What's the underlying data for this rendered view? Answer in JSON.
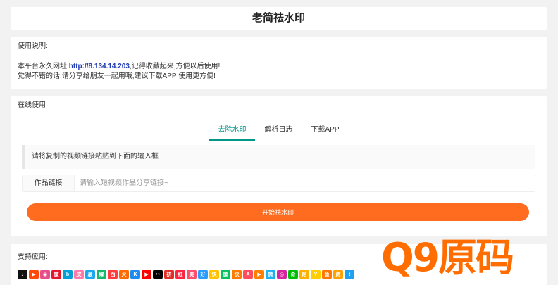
{
  "title": "老简祛水印",
  "info": {
    "header": "使用说明:",
    "line1_prefix": "本平台永久网址:",
    "url": "http://8.134.14.203",
    "line1_suffix": ",记得收藏起来,方便以后使用!",
    "line2": "觉得不错的话,请分享给朋友一起用哦,建议下载APP 使用更方便!"
  },
  "tool": {
    "header": "在线使用",
    "tabs": [
      {
        "label": "去除水印"
      },
      {
        "label": "解析日志"
      },
      {
        "label": "下载APP"
      }
    ],
    "notice": "请将复制的视频链接粘贴到下面的输入框",
    "input_label": "作品链接",
    "input_placeholder": "请输入短视频作品分享链接~",
    "input_value": "",
    "button_label": "开始祛水印"
  },
  "apps": {
    "header": "支持应用:",
    "icons": [
      {
        "name": "douyin-icon",
        "color": "#111111",
        "glyph": "♪"
      },
      {
        "name": "kuaishou-icon",
        "color": "#ff4906",
        "glyph": "▶"
      },
      {
        "name": "weishi-icon",
        "color": "#e64d8a",
        "glyph": "◉"
      },
      {
        "name": "weibo-icon",
        "color": "#e6162d",
        "glyph": "微"
      },
      {
        "name": "bilibili-icon",
        "color": "#00a1d6",
        "glyph": "b"
      },
      {
        "name": "pipixia-icon",
        "color": "#ff7aa8",
        "glyph": "皮"
      },
      {
        "name": "zuiyou-icon",
        "color": "#1aa7ee",
        "glyph": "最"
      },
      {
        "name": "lvzhou-icon",
        "color": "#16b86e",
        "glyph": "绿"
      },
      {
        "name": "xigua-icon",
        "color": "#ff3b3b",
        "glyph": "西"
      },
      {
        "name": "huoshan-icon",
        "color": "#ff6a00",
        "glyph": "火"
      },
      {
        "name": "kg-icon",
        "color": "#1c8cf0",
        "glyph": "K"
      },
      {
        "name": "youtube-icon",
        "color": "#ff0000",
        "glyph": "▶"
      },
      {
        "name": "capcut-icon",
        "color": "#000000",
        "glyph": "✂"
      },
      {
        "name": "pinduoduo-icon",
        "color": "#e02e24",
        "glyph": "拼"
      },
      {
        "name": "xiaohongshu-icon",
        "color": "#ff2442",
        "glyph": "红"
      },
      {
        "name": "meipai-icon",
        "color": "#ff4d6d",
        "glyph": "美"
      },
      {
        "name": "haokan-icon",
        "color": "#2a9bff",
        "glyph": "好"
      },
      {
        "name": "kuaikan-icon",
        "color": "#ffc300",
        "glyph": "快"
      },
      {
        "name": "wechat-icon",
        "color": "#07c160",
        "glyph": "微"
      },
      {
        "name": "kuaishou-lite-icon",
        "color": "#ff7b00",
        "glyph": "快"
      },
      {
        "name": "acfun-icon",
        "color": "#fd4c5c",
        "glyph": "A"
      },
      {
        "name": "tencent-video-icon",
        "color": "#ff7f00",
        "glyph": "▶"
      },
      {
        "name": "weishi-lite-icon",
        "color": "#20b2f0",
        "glyph": "微"
      },
      {
        "name": "instagram-icon",
        "color": "#d6249f",
        "glyph": "◎"
      },
      {
        "name": "iqiyi-icon",
        "color": "#00be06",
        "glyph": "奇"
      },
      {
        "name": "momo-icon",
        "color": "#ffb100",
        "glyph": "陌"
      },
      {
        "name": "yy-icon",
        "color": "#ffcd00",
        "glyph": "Y"
      },
      {
        "name": "douyu-icon",
        "color": "#ff7700",
        "glyph": "鱼"
      },
      {
        "name": "huya-icon",
        "color": "#ffa200",
        "glyph": "虎"
      },
      {
        "name": "twitter-icon",
        "color": "#1da1f2",
        "glyph": "t"
      }
    ]
  },
  "watermark": {
    "text": "Q9原码",
    "color": "#ff6c00"
  }
}
